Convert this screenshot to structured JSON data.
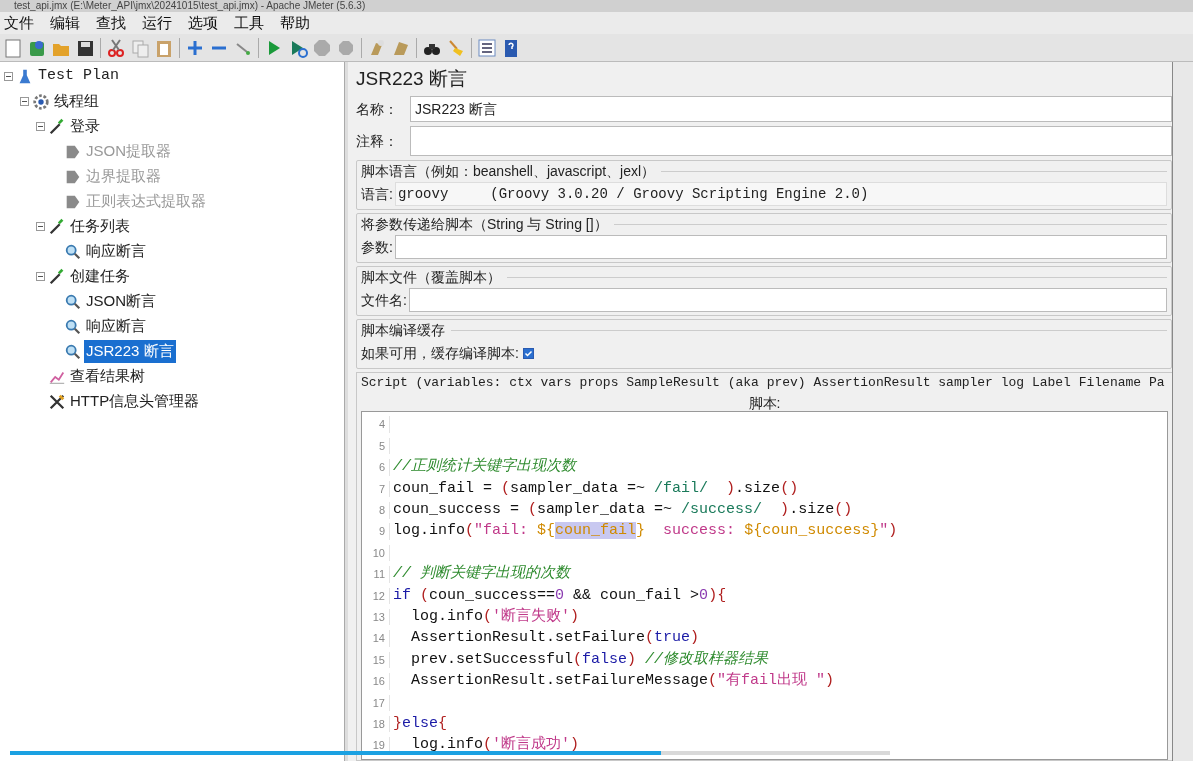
{
  "window": {
    "title": "test_api.jmx (E:\\Meter_API\\jmx\\20241015\\test_api.jmx) - Apache JMeter (5.6.3)"
  },
  "menu": [
    "文件",
    "编辑",
    "查找",
    "运行",
    "选项",
    "工具",
    "帮助"
  ],
  "tree": [
    {
      "label": "Test Plan",
      "kind": "plan",
      "expanded": true,
      "selected": false,
      "disabled": false,
      "children": [
        {
          "label": "线程组",
          "kind": "threads",
          "expanded": true,
          "selected": false,
          "disabled": false,
          "children": [
            {
              "label": "登录",
              "kind": "sampler",
              "expanded": true,
              "selected": false,
              "disabled": false,
              "children": [
                {
                  "label": "JSON提取器",
                  "kind": "extractor",
                  "selected": false,
                  "disabled": true
                },
                {
                  "label": "边界提取器",
                  "kind": "extractor",
                  "selected": false,
                  "disabled": true
                },
                {
                  "label": "正则表达式提取器",
                  "kind": "extractor",
                  "selected": false,
                  "disabled": true
                }
              ]
            },
            {
              "label": "任务列表",
              "kind": "sampler",
              "expanded": true,
              "selected": false,
              "disabled": false,
              "children": [
                {
                  "label": "响应断言",
                  "kind": "assertion",
                  "selected": false,
                  "disabled": false
                }
              ]
            },
            {
              "label": "创建任务",
              "kind": "sampler",
              "expanded": true,
              "selected": false,
              "disabled": false,
              "children": [
                {
                  "label": "JSON断言",
                  "kind": "assertion",
                  "selected": false,
                  "disabled": false
                },
                {
                  "label": "响应断言",
                  "kind": "assertion",
                  "selected": false,
                  "disabled": false
                },
                {
                  "label": "JSR223 断言",
                  "kind": "assertion",
                  "selected": true,
                  "disabled": false
                }
              ]
            },
            {
              "label": "查看结果树",
              "kind": "listener",
              "selected": false,
              "disabled": false
            },
            {
              "label": "HTTP信息头管理器",
              "kind": "config",
              "selected": false,
              "disabled": false
            }
          ]
        }
      ]
    }
  ],
  "panel": {
    "title": "JSR223 断言",
    "name_label": "名称：",
    "name_value": "JSR223 断言",
    "comment_label": "注释：",
    "groups": [
      {
        "legend": "脚本语言（例如：beanshell、javascript、jexl）",
        "label": "语言:",
        "value": "groovy     (Groovy 3.0.20 / Groovy Scripting Engine 2.0)",
        "kind": "combo"
      },
      {
        "legend": "将参数传递给脚本（String 与 String []）",
        "label": "参数:",
        "kind": "field"
      },
      {
        "legend": "脚本文件（覆盖脚本）",
        "label": "文件名:",
        "kind": "field"
      },
      {
        "legend": "脚本编译缓存",
        "label": "如果可用，缓存编译脚本:",
        "kind": "checkbox",
        "checked": true
      }
    ],
    "script_legend": "Script (variables: ctx vars props SampleResult (aka prev) AssertionResult sampler log Label Filename Pa",
    "script_caption": "脚本:",
    "code": [
      {
        "number": "4"
      },
      {
        "number": "5"
      },
      {
        "number": "6",
        "tokens": [
          {
            "kind": "comment",
            "text": "//正则统计关键字出现次数"
          }
        ]
      },
      {
        "number": "7",
        "tokens": [
          {
            "kind": "plain",
            "text": "coun_fail = "
          },
          {
            "kind": "paren",
            "text": "("
          },
          {
            "kind": "plain",
            "text": "sampler_data =~ "
          },
          {
            "kind": "regex",
            "text": "/fail/  "
          },
          {
            "kind": "paren",
            "text": ")"
          },
          {
            "kind": "plain",
            "text": ".size"
          },
          {
            "kind": "paren",
            "text": "()"
          }
        ]
      },
      {
        "number": "8",
        "tokens": [
          {
            "kind": "plain",
            "text": "coun_success = "
          },
          {
            "kind": "paren",
            "text": "("
          },
          {
            "kind": "plain",
            "text": "sampler_data =~ "
          },
          {
            "kind": "regex",
            "text": "/success/  "
          },
          {
            "kind": "paren",
            "text": ")"
          },
          {
            "kind": "plain",
            "text": ".size"
          },
          {
            "kind": "paren",
            "text": "()"
          }
        ]
      },
      {
        "number": "9",
        "tokens": [
          {
            "kind": "plain",
            "text": "log.info"
          },
          {
            "kind": "paren",
            "text": "("
          },
          {
            "kind": "string",
            "text": "\"fail: "
          },
          {
            "kind": "interp",
            "text": "${"
          },
          {
            "kind": "selection",
            "text": "coun_fail"
          },
          {
            "kind": "interp",
            "text": "}"
          },
          {
            "kind": "string",
            "text": "  success: "
          },
          {
            "kind": "interp",
            "text": "${coun_success}"
          },
          {
            "kind": "string",
            "text": "\""
          },
          {
            "kind": "paren",
            "text": ")"
          }
        ]
      },
      {
        "number": "10"
      },
      {
        "number": "11",
        "tokens": [
          {
            "kind": "comment",
            "text": "// 判断关键字出现的次数"
          }
        ]
      },
      {
        "number": "12",
        "tokens": [
          {
            "kind": "keyword",
            "text": "if"
          },
          {
            "kind": "paren",
            "text": " ("
          },
          {
            "kind": "plain",
            "text": "coun_success=="
          },
          {
            "kind": "number",
            "text": "0"
          },
          {
            "kind": "plain",
            "text": " && coun_fail >"
          },
          {
            "kind": "number",
            "text": "0"
          },
          {
            "kind": "paren",
            "text": "){"
          }
        ]
      },
      {
        "number": "13",
        "tokens": [
          {
            "kind": "plain",
            "text": "  log.info"
          },
          {
            "kind": "paren",
            "text": "("
          },
          {
            "kind": "string",
            "text": "'断言失败'"
          },
          {
            "kind": "paren",
            "text": ")"
          }
        ]
      },
      {
        "number": "14",
        "tokens": [
          {
            "kind": "plain",
            "text": "  AssertionResult.setFailure"
          },
          {
            "kind": "paren",
            "text": "("
          },
          {
            "kind": "keyword",
            "text": "true"
          },
          {
            "kind": "paren",
            "text": ")"
          }
        ]
      },
      {
        "number": "15",
        "tokens": [
          {
            "kind": "plain",
            "text": "  prev.setSuccessful"
          },
          {
            "kind": "paren",
            "text": "("
          },
          {
            "kind": "keyword",
            "text": "false"
          },
          {
            "kind": "paren",
            "text": ")"
          },
          {
            "kind": "comment",
            "text": " //修改取样器结果"
          }
        ]
      },
      {
        "number": "16",
        "tokens": [
          {
            "kind": "plain",
            "text": "  AssertionResult.setFailureMessage"
          },
          {
            "kind": "paren",
            "text": "("
          },
          {
            "kind": "string",
            "text": "\"有fail出现 \""
          },
          {
            "kind": "paren",
            "text": ")"
          }
        ]
      },
      {
        "number": "17"
      },
      {
        "number": "18",
        "tokens": [
          {
            "kind": "paren",
            "text": "}"
          },
          {
            "kind": "keyword",
            "text": "else"
          },
          {
            "kind": "paren",
            "text": "{"
          }
        ]
      },
      {
        "number": "19",
        "tokens": [
          {
            "kind": "plain",
            "text": "  log.info"
          },
          {
            "kind": "paren",
            "text": "("
          },
          {
            "kind": "string",
            "text": "'断言成功'"
          },
          {
            "kind": "paren",
            "text": ")"
          }
        ]
      }
    ]
  },
  "progress": {
    "level": 0.74
  }
}
